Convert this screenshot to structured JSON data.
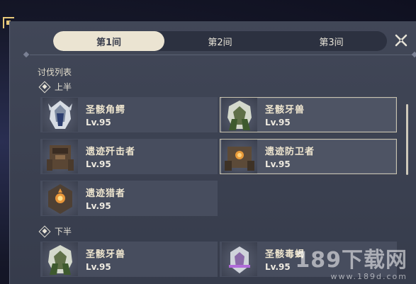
{
  "tabs": [
    {
      "label": "第1间",
      "active": true
    },
    {
      "label": "第2间",
      "active": false
    },
    {
      "label": "第3间",
      "active": false
    }
  ],
  "close_icon": "close-icon",
  "section_title": "讨伐列表",
  "upper_half": {
    "label": "上半",
    "enemies": [
      {
        "name": "圣骸角鳄",
        "level": "Lv.95",
        "highlighted": false,
        "icon": "sacred-horned-croc-portrait"
      },
      {
        "name": "圣骸牙兽",
        "level": "Lv.95",
        "highlighted": true,
        "icon": "sacred-tooth-beast-portrait"
      },
      {
        "name": "遗迹歼击者",
        "level": "Lv.95",
        "highlighted": false,
        "icon": "ruin-destroyer-portrait"
      },
      {
        "name": "遗迹防卫者",
        "level": "Lv.95",
        "highlighted": true,
        "icon": "ruin-defender-portrait"
      },
      {
        "name": "遗迹猎者",
        "level": "Lv.95",
        "highlighted": false,
        "icon": "ruin-hunter-portrait"
      }
    ]
  },
  "lower_half": {
    "label": "下半",
    "enemies": [
      {
        "name": "圣骸牙兽",
        "level": "Lv.95",
        "highlighted": false,
        "icon": "sacred-tooth-beast-portrait"
      },
      {
        "name": "圣骸毒蝎",
        "level": "Lv.95",
        "highlighted": false,
        "icon": "sacred-scorpion-portrait"
      }
    ]
  },
  "watermark": {
    "main": "189下载网",
    "sub": "www.189d.com"
  },
  "colors": {
    "panel": "#3b4152",
    "card": "#474d5e",
    "active_tab": "#ebe4d2",
    "gold": "#e8c97a"
  }
}
